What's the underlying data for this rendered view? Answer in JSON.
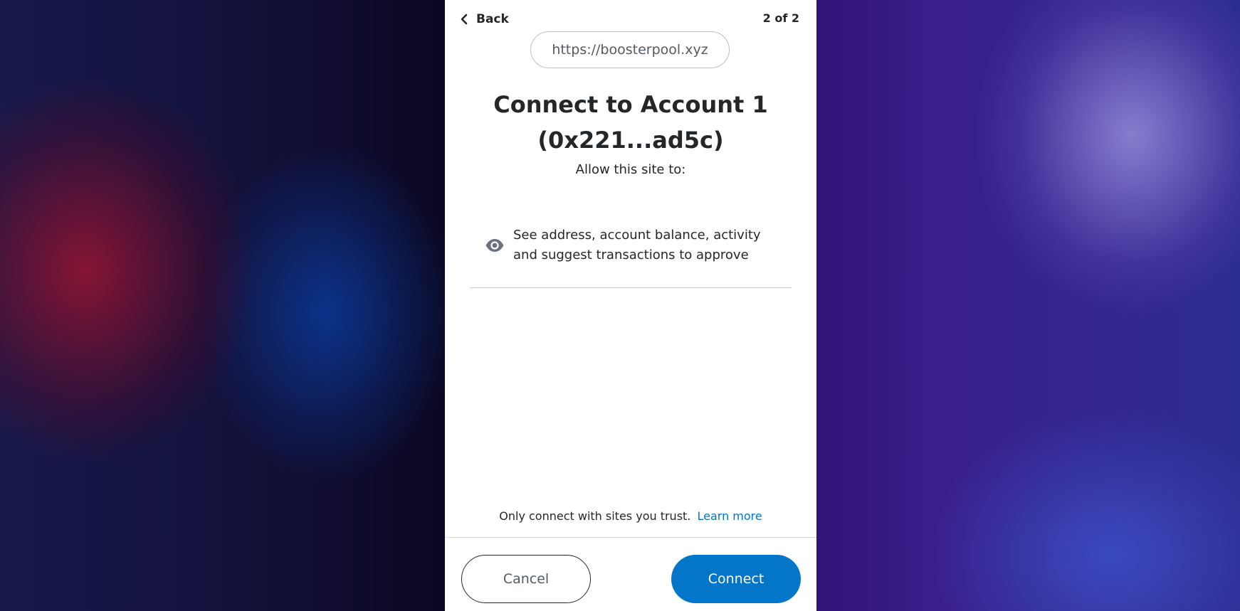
{
  "header": {
    "back_label": "Back",
    "page_indicator": "2 of 2"
  },
  "site": {
    "url": "https://boosterpool.xyz"
  },
  "main": {
    "title_line1": "Connect to Account 1",
    "title_line2": "(0x221...ad5c)",
    "subtitle": "Allow this site to:",
    "permissions": [
      {
        "icon": "eye-icon",
        "line1": "See address, account balance, activity",
        "line2": "and suggest transactions to approve"
      }
    ]
  },
  "footer": {
    "note": "Only connect with sites you trust.",
    "learn_more": "Learn more",
    "cancel_label": "Cancel",
    "connect_label": "Connect"
  },
  "colors": {
    "primary": "#0376c9",
    "text": "#24272a",
    "muted": "#535a61",
    "border": "#bbc0c5"
  }
}
